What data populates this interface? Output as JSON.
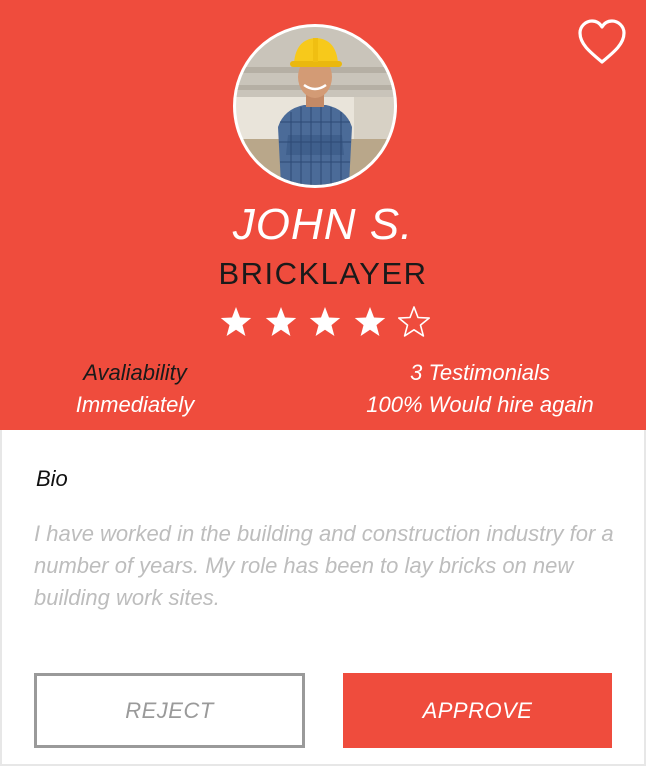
{
  "profile": {
    "name": "JOHN S.",
    "role": "BRICKLAYER",
    "rating": 4,
    "rating_max": 5
  },
  "stats": {
    "availability_label": "Avaliability",
    "availability_value": "Immediately",
    "testimonials_label": "3 Testimonials",
    "hire_again_value": "100% Would hire again"
  },
  "bio": {
    "title": "Bio",
    "text": "I have worked in the building and construction industry for a number of years. My role has been to lay bricks on new building work sites."
  },
  "actions": {
    "reject_label": "REJECT",
    "approve_label": "APPROVE"
  },
  "icons": {
    "favorite": "heart-outline-icon",
    "rating": "star-icon"
  },
  "colors": {
    "accent": "#ef4c3d",
    "muted_text": "#bdbdbd",
    "reject_border": "#9a9a9a"
  }
}
